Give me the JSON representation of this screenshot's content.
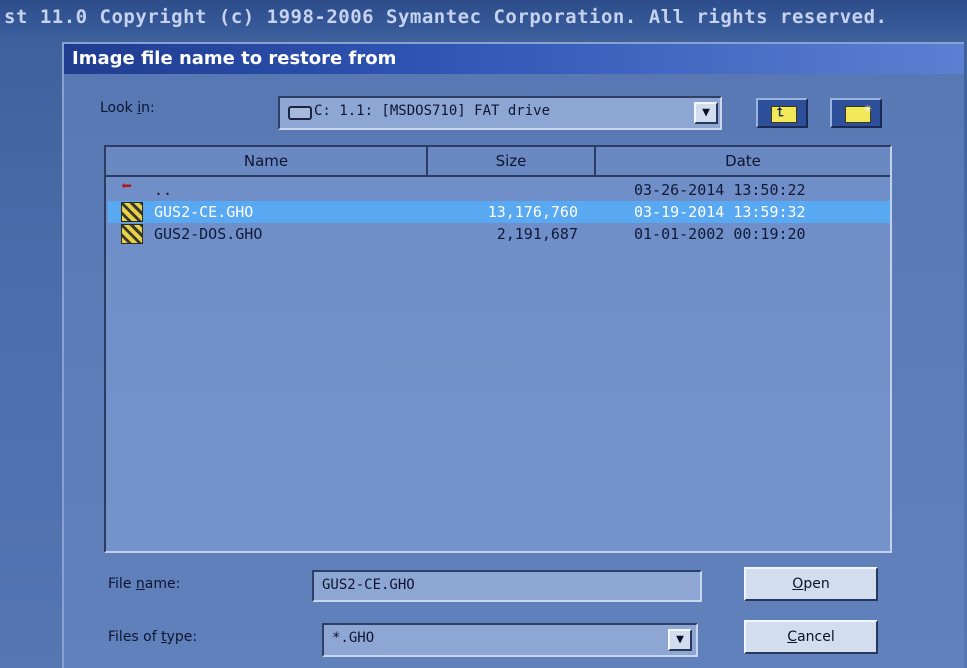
{
  "banner": {
    "text": "st 11.0   Copyright (c) 1998-2006 Symantec Corporation. All rights reserved."
  },
  "dialog": {
    "title": "Image file name to restore from",
    "look_in": {
      "label_pre": "Look ",
      "label_key": "i",
      "label_post": "n:",
      "value": "C: 1.1: [MSDOS710] FAT drive"
    },
    "toolbar": {
      "up_icon": "folder-up-icon",
      "new_icon": "new-folder-icon"
    },
    "columns": [
      "Name",
      "Size",
      "Date"
    ],
    "rows": [
      {
        "name": "..",
        "size": "",
        "date": "03-26-2014 13:50:22",
        "icon": "back-arrow-icon",
        "selected": false
      },
      {
        "name": "GUS2-CE.GHO",
        "size": "13,176,760",
        "date": "03-19-2014 13:59:32",
        "icon": "ghost-image-icon",
        "selected": true
      },
      {
        "name": "GUS2-DOS.GHO",
        "size": "2,191,687",
        "date": "01-01-2002 00:19:20",
        "icon": "ghost-image-icon",
        "selected": false
      }
    ],
    "file_name": {
      "label_pre": "File ",
      "label_key": "n",
      "label_post": "ame:",
      "value": "GUS2-CE.GHO"
    },
    "file_type": {
      "label_pre": "Files of ",
      "label_key": "t",
      "label_post": "ype:",
      "value": "*.GHO"
    },
    "open_button": {
      "key": "O",
      "rest": "pen"
    },
    "cancel_button": {
      "key": "C",
      "rest": "ancel"
    },
    "dropdown_glyph": "▼",
    "colors": {
      "selection": "#58a8f2",
      "title_bar": "#1f3c8f"
    }
  }
}
